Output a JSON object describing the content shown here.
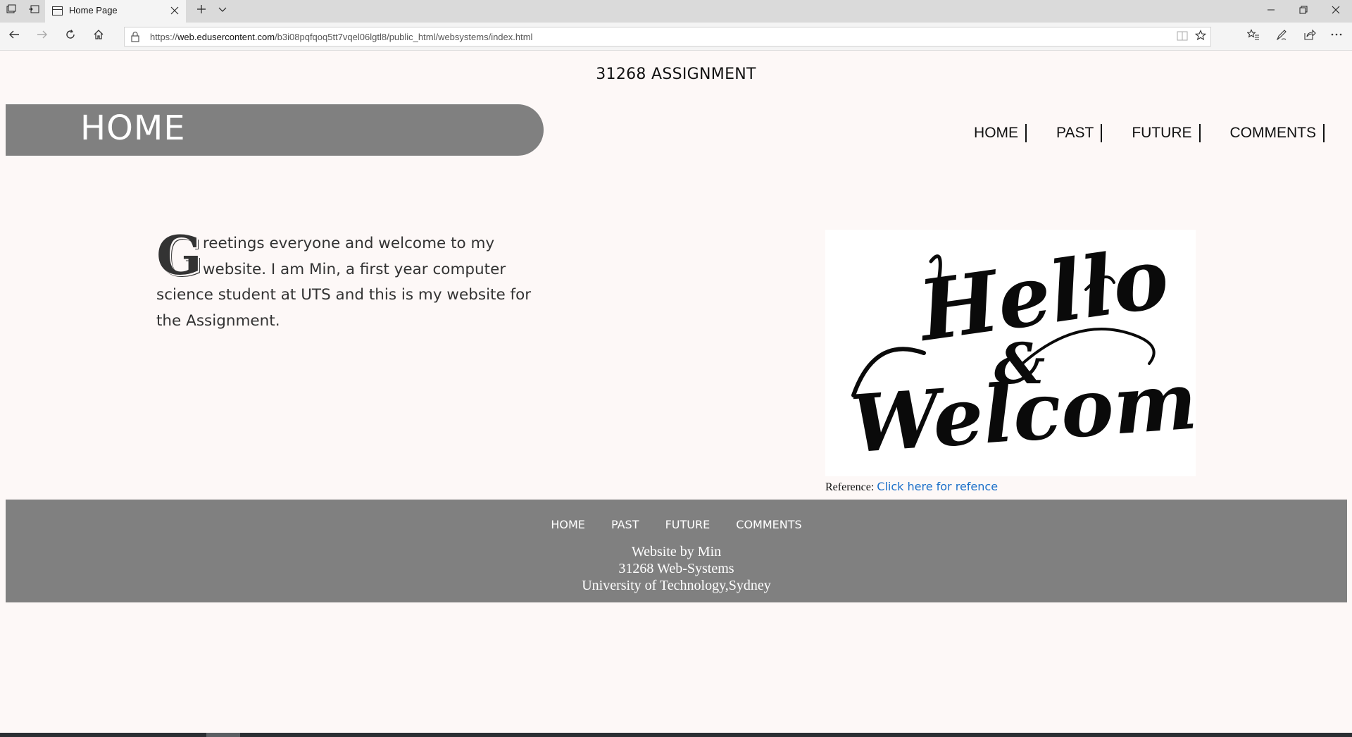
{
  "browser": {
    "tab": {
      "title": "Home Page"
    },
    "url": {
      "prefix": "https://",
      "host": "web.edusercontent.com",
      "path": "/b3i08pqfqoq5tt7vqel06lgtl8/public_html/websystems/index.html"
    },
    "icons": {
      "tab_actions": [
        "tab-set-aside-icon",
        "tab-restore-icon"
      ],
      "new_tab": "plus-icon",
      "tab_list": "chevron-down-icon",
      "window": [
        "minimize-icon",
        "restore-icon",
        "close-icon"
      ],
      "nav": [
        "back-icon",
        "forward-icon",
        "refresh-icon",
        "home-icon"
      ],
      "address": [
        "lock-icon",
        "reading-view-icon",
        "favorite-star-icon"
      ],
      "tools": [
        "favorites-hub-icon",
        "notes-pen-icon",
        "share-icon",
        "more-icon"
      ]
    }
  },
  "site": {
    "title": "31268 ASSIGNMENT",
    "banner_title": "HOME",
    "nav": [
      "HOME",
      "PAST",
      "FUTURE",
      "COMMENTS"
    ],
    "intro": {
      "dropcap": "G",
      "text": "reetings everyone and welcome to my website. I am Min, a first year computer science student at UTS and this is my website for the Assignment."
    },
    "image": {
      "line1": "Hello",
      "amp": "&",
      "line2": "Welcome!"
    },
    "reference": {
      "label": "Reference:",
      "link_text": "Click here for refence"
    },
    "footer": {
      "nav": [
        "HOME",
        "PAST",
        "FUTURE",
        "COMMENTS"
      ],
      "line1": "Website by Min",
      "line2": "31268 Web-Systems",
      "line3": "University of Technology,Sydney"
    }
  },
  "colors": {
    "page_bg": "#fdf8f7",
    "banner": "#808080",
    "link": "#1a6fc9"
  }
}
